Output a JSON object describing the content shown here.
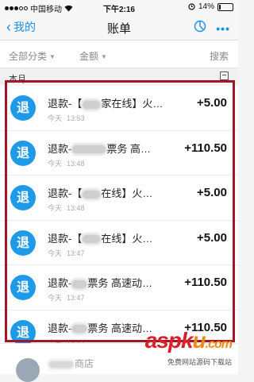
{
  "status_bar": {
    "carrier": "中国移动",
    "time": "下午2:16",
    "battery": "14%",
    "battery_level": 0.14
  },
  "nav": {
    "back_label": "我的",
    "title": "账单"
  },
  "filter": {
    "category": "全部分类",
    "amount": "金额",
    "search": "搜索"
  },
  "section": {
    "label": "本月"
  },
  "avatar_text": "退",
  "transactions": [
    {
      "name_prefix": "退款-【",
      "name_suffix": "家在线】火…",
      "date": "今天",
      "time": "13:53",
      "amount": "+5.00"
    },
    {
      "name_prefix": "退款-",
      "name_suffix": "票务 高…",
      "date": "今天",
      "time": "13:48",
      "amount": "+110.50"
    },
    {
      "name_prefix": "退款-【",
      "name_suffix": "在线】火…",
      "date": "今天",
      "time": "13:48",
      "amount": "+5.00"
    },
    {
      "name_prefix": "退款-【",
      "name_suffix": "在线】火…",
      "date": "今天",
      "time": "13:47",
      "amount": "+5.00"
    },
    {
      "name_prefix": "退款-",
      "name_suffix": "票务 高速动…",
      "date": "今天",
      "time": "13:47",
      "amount": "+110.50"
    },
    {
      "name_prefix": "退款-",
      "name_suffix": "票务 高速动…",
      "date": "今天",
      "time": "13:47",
      "amount": "+110.50"
    }
  ],
  "partial_row": {
    "text": "商店"
  },
  "watermark": {
    "brand_a": "asp",
    "brand_k": "k",
    "brand_u": "u",
    "brand_dot": ".com",
    "tagline": "免费网站源码下载站"
  },
  "colors": {
    "accent": "#1a8ee8",
    "avatar": "#1f9ae9",
    "highlight": "#a3162a"
  }
}
